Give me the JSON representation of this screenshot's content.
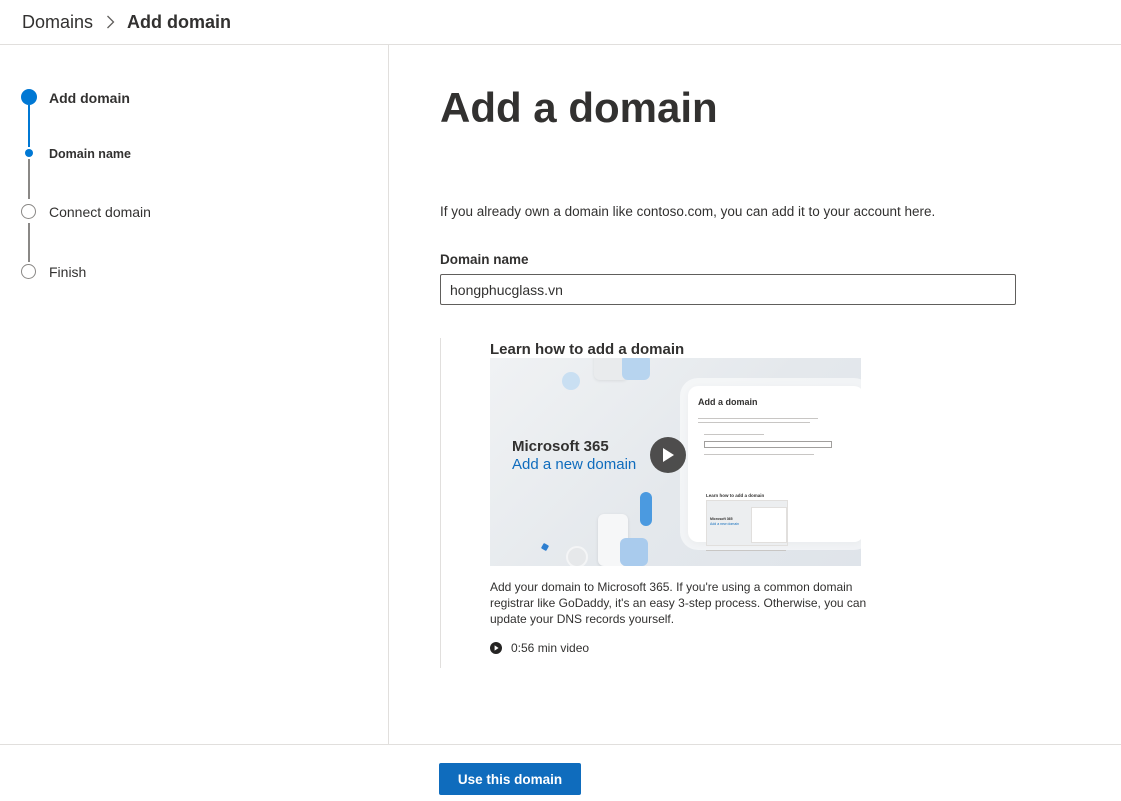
{
  "breadcrumb": {
    "root": "Domains",
    "current": "Add domain",
    "separator_icon": "chevron-right-icon"
  },
  "wizard": {
    "steps": [
      {
        "label": "Add domain",
        "state": "current"
      },
      {
        "label": "Domain name",
        "state": "current-substep"
      },
      {
        "label": "Connect domain",
        "state": "upcoming"
      },
      {
        "label": "Finish",
        "state": "upcoming"
      }
    ]
  },
  "main": {
    "title": "Add a domain",
    "intro": "If you already own a domain like contoso.com, you can add it to your account here.",
    "domain_field": {
      "label": "Domain name",
      "value": "hongphucglass.vn"
    }
  },
  "learn": {
    "title": "Learn how to add a domain",
    "video": {
      "brand": "Microsoft 365",
      "subtitle": "Add a new domain",
      "preview_title": "Add a domain",
      "preview_learn": "Learn how to add a domain",
      "preview_thumb_brand": "Microsoft 365",
      "preview_thumb_sub": "Add a new domain",
      "play_icon": "play-icon"
    },
    "description": "Add your domain to Microsoft 365. If you're using a common domain registrar like GoDaddy, it's an easy 3-step process. Otherwise, you can update your DNS records yourself.",
    "duration": "0:56 min video"
  },
  "footer": {
    "primary_label": "Use this domain"
  },
  "colors": {
    "accent": "#0078d4",
    "button": "#0f6cbd",
    "text": "#323130",
    "divider": "#e1dfdd",
    "inactive": "#8a8886"
  }
}
